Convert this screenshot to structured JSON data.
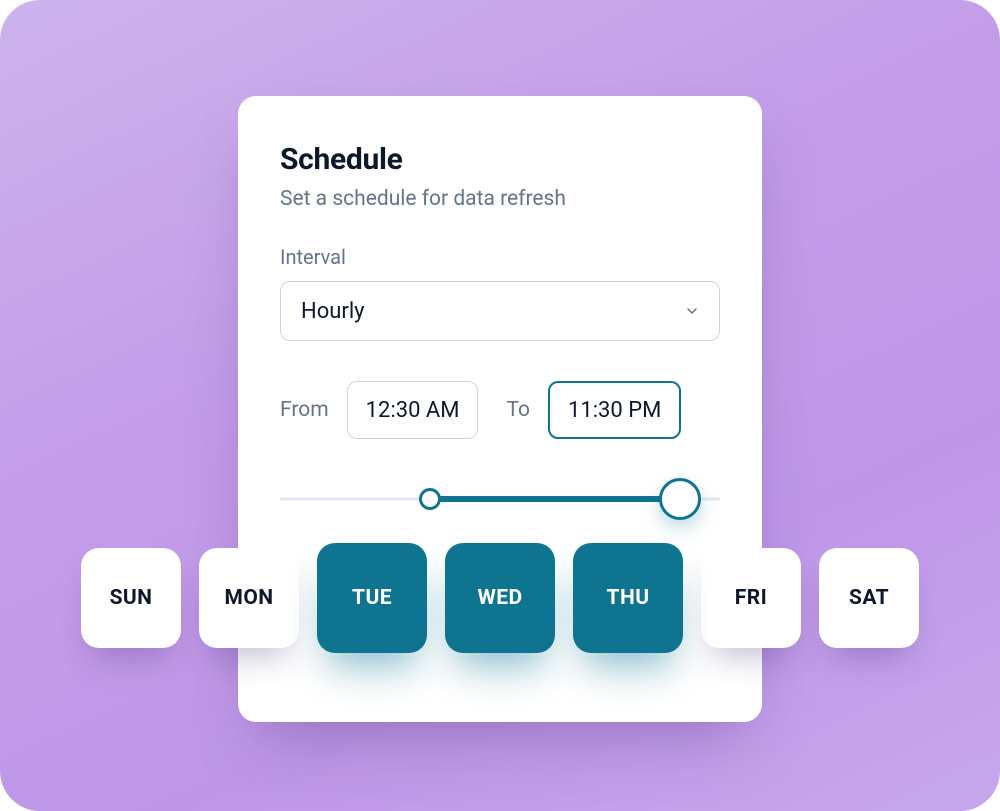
{
  "card": {
    "title": "Schedule",
    "subtitle": "Set a schedule for data refresh"
  },
  "interval": {
    "label": "Interval",
    "value": "Hourly"
  },
  "time": {
    "from_label": "From",
    "from_value": "12:30 AM",
    "to_label": "To",
    "to_value": "11:30 PM"
  },
  "slider": {
    "start_pct": 34,
    "end_pct": 91
  },
  "days": [
    {
      "label": "SUN",
      "selected": false
    },
    {
      "label": "MON",
      "selected": false
    },
    {
      "label": "TUE",
      "selected": true
    },
    {
      "label": "WED",
      "selected": true
    },
    {
      "label": "THU",
      "selected": true
    },
    {
      "label": "FRI",
      "selected": false
    },
    {
      "label": "SAT",
      "selected": false
    }
  ],
  "colors": {
    "accent": "#0e7490",
    "bg_gradient_from": "#cdb3ec",
    "bg_gradient_to": "#c7a8ec",
    "text_muted": "#64748b",
    "text": "#0f172a",
    "border": "#cbd5e1"
  }
}
